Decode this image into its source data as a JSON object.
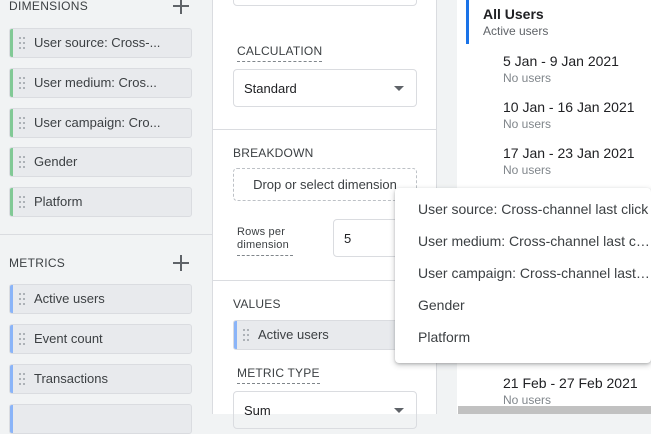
{
  "variables": {
    "dimensions_heading": "DIMENSIONS",
    "dimensions": [
      "User source: Cross-...",
      "User medium: Cros...",
      "User campaign: Cro...",
      "Gender",
      "Platform"
    ],
    "metrics_heading": "METRICS",
    "metrics": [
      "Active users",
      "Event count",
      "Transactions"
    ]
  },
  "tab_settings": {
    "calculation_label": "CALCULATION",
    "calculation_value": "Standard",
    "breakdown_label": "BREAKDOWN",
    "breakdown_drop": "Drop or select dimension",
    "rows_per_label": "Rows per dimension",
    "rows_per_value": "5",
    "values_label": "VALUES",
    "values_chip": "Active users",
    "metric_type_label": "METRIC TYPE",
    "metric_type_value": "Sum"
  },
  "canvas": {
    "segment_title": "All Users",
    "segment_sub": "Active users",
    "rows": [
      {
        "label": "5 Jan - 9 Jan 2021",
        "sub": "No users"
      },
      {
        "label": "10 Jan - 16 Jan 2021",
        "sub": "No users"
      },
      {
        "label": "17 Jan - 23 Jan 2021",
        "sub": "No users"
      }
    ],
    "last_row": {
      "label": "21 Feb - 27 Feb 2021",
      "sub": "No users"
    }
  },
  "menu": {
    "items": [
      "User source: Cross-channel last click",
      "User medium: Cross-channel last cli...",
      "User campaign: Cross-channel last ...",
      "Gender",
      "Platform"
    ]
  },
  "colors": {
    "dimension_accent": "#81c995",
    "metric_accent": "#8ab4f8",
    "segment_accent": "#1a73e8"
  }
}
